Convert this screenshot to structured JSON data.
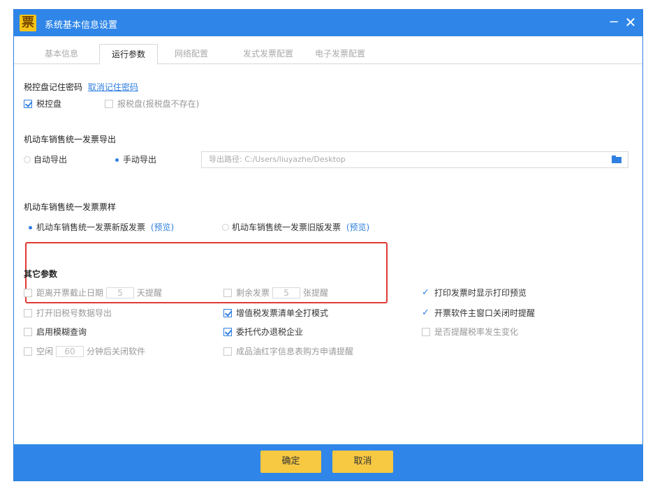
{
  "window": {
    "title": "系统基本信息设置",
    "minimize": "−",
    "close": "✕"
  },
  "tabs": [
    {
      "label": "基本信息"
    },
    {
      "label": "运行参数",
      "active": true
    },
    {
      "label": "网络配置"
    },
    {
      "label": "发式发票配置"
    },
    {
      "label": "电子发票配置"
    }
  ],
  "tax_disk": {
    "title": "税控盘记住密码",
    "cancel_link": "取消记住密码",
    "opt1": "税控盘",
    "opt2": "报税盘(报税盘不存在)"
  },
  "export": {
    "title": "机动车销售统一发票导出",
    "auto": "自动导出",
    "manual": "手动导出",
    "path_value": "导出路径: C:/Users/liuyazhe/Desktop"
  },
  "style": {
    "title": "机动车销售统一发票票样",
    "new_label": "机动车销售统一发票新版发票",
    "old_label": "机动车销售统一发票旧版发票",
    "preview": "(预览)"
  },
  "other": {
    "title": "其它参数",
    "deadline_pre": "距离开票截止日期",
    "deadline_val": "5",
    "deadline_post": "天提醒",
    "remain_pre": "剩余发票",
    "remain_val": "5",
    "remain_post": "张提醒",
    "print_preview": "打印发票时显示打印预览",
    "export_old": "打开旧税号数据导出",
    "full_print": "增值税发票清单全打模式",
    "close_remind": "开票软件主窗口关闭时提醒",
    "fuzzy_search": "启用模糊查询",
    "agent": "委托代办退税企业",
    "rate_change": "是否提醒税率发生变化",
    "idle_pre": "空闲",
    "idle_val": "60",
    "idle_post": "分钟后关闭软件",
    "oil": "成品油红字信息表购方申请提醒"
  },
  "footer": {
    "ok": "确定",
    "cancel": "取消"
  }
}
